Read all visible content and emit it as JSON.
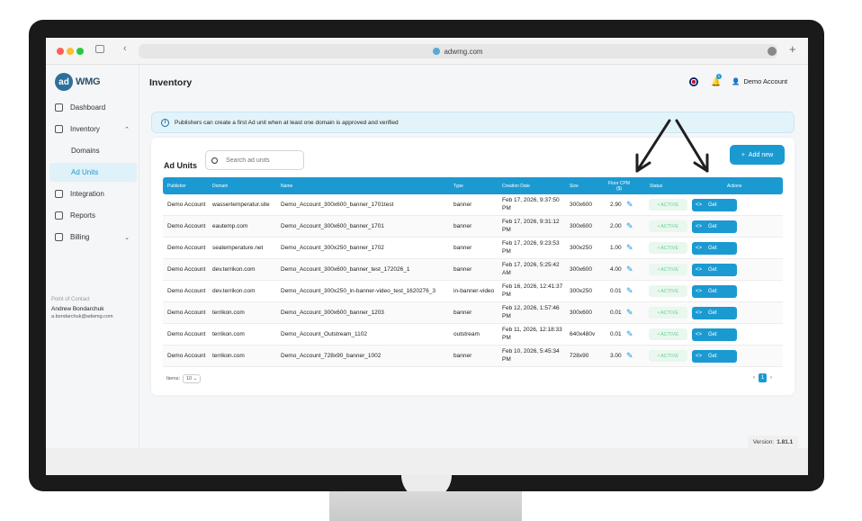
{
  "browser": {
    "url": "adwmg.com"
  },
  "logo": {
    "mark": "ad",
    "text": "WMG"
  },
  "sidebar": {
    "items": [
      {
        "label": "Dashboard",
        "icon": "home-icon"
      },
      {
        "label": "Inventory",
        "icon": "briefcase-icon",
        "expanded": true
      },
      {
        "label": "Domains"
      },
      {
        "label": "Ad Units",
        "active": true
      },
      {
        "label": "Integration",
        "icon": "integration-icon"
      },
      {
        "label": "Reports",
        "icon": "report-icon"
      },
      {
        "label": "Billing",
        "icon": "billing-icon"
      }
    ],
    "poc_label": "Point of Contact",
    "poc_name": "Andrew Bondarchuk",
    "poc_email": "a.bondarchuk@adwmg.com"
  },
  "header": {
    "title": "Inventory",
    "account": "Demo Account",
    "notif_count": "0"
  },
  "info_banner": "Publishers can create a first Ad unit when at least one domain is approved and verified",
  "card": {
    "title": "Ad Units",
    "search_placeholder": "Search ad units",
    "add_label": "Add new"
  },
  "table": {
    "headers": [
      "Publisher",
      "Domain",
      "Name",
      "Type",
      "Creation Date",
      "Size",
      "Floor CPM ($)",
      "Status",
      "Actions"
    ],
    "rows": [
      {
        "publisher": "Demo Account",
        "domain": "wassertemperatur.site",
        "name": "Demo_Account_300x600_banner_1701test",
        "type": "banner",
        "date": "Feb 17, 2026, 9:37:50 PM",
        "size": "300x600",
        "cpm": "2.90",
        "status": "• ACTIVE",
        "action": "Get"
      },
      {
        "publisher": "Demo Account",
        "domain": "eautemp.com",
        "name": "Demo_Account_300x600_banner_1701",
        "type": "banner",
        "date": "Feb 17, 2026, 9:31:12 PM",
        "size": "300x600",
        "cpm": "2.00",
        "status": "• ACTIVE",
        "action": "Get"
      },
      {
        "publisher": "Demo Account",
        "domain": "seatemperature.net",
        "name": "Demo_Account_300x250_banner_1702",
        "type": "banner",
        "date": "Feb 17, 2026, 9:23:53 PM",
        "size": "300x250",
        "cpm": "1.00",
        "status": "• ACTIVE",
        "action": "Get"
      },
      {
        "publisher": "Demo Account",
        "domain": "dev.terrikon.com",
        "name": "Demo_Account_300x600_banner_test_172026_1",
        "type": "banner",
        "date": "Feb 17, 2026, 5:25:42 AM",
        "size": "300x600",
        "cpm": "4.00",
        "status": "• ACTIVE",
        "action": "Get"
      },
      {
        "publisher": "Demo Account",
        "domain": "dev.terrikon.com",
        "name": "Demo_Account_300x250_in-banner-video_test_1620276_3",
        "type": "in-banner-video",
        "date": "Feb 16, 2026, 12:41:37 PM",
        "size": "300x250",
        "cpm": "0.01",
        "status": "• ACTIVE",
        "action": "Get"
      },
      {
        "publisher": "Demo Account",
        "domain": "terrikon.com",
        "name": "Demo_Account_300x600_banner_1203",
        "type": "banner",
        "date": "Feb 12, 2026, 1:57:46 PM",
        "size": "300x600",
        "cpm": "0.01",
        "status": "• ACTIVE",
        "action": "Get"
      },
      {
        "publisher": "Demo Account",
        "domain": "terrikon.com",
        "name": "Demo_Account_Outstream_1102",
        "type": "outstream",
        "date": "Feb 11, 2026, 12:18:33 PM",
        "size": "640x480v",
        "cpm": "0.01",
        "status": "• ACTIVE",
        "action": "Get"
      },
      {
        "publisher": "Demo Account",
        "domain": "terrikon.com",
        "name": "Demo_Account_728x90_banner_1002",
        "type": "banner",
        "date": "Feb 10, 2026, 5:45:34 PM",
        "size": "728x90",
        "cpm": "3.00",
        "status": "• ACTIVE",
        "action": "Get"
      }
    ]
  },
  "pagination": {
    "items_label": "Items:",
    "items_value": "10",
    "current_page": "1"
  },
  "version": {
    "label": "Version:",
    "value": "1.81.1"
  },
  "colors": {
    "accent": "#1b9ad2",
    "active_status": "#6fcf97"
  }
}
